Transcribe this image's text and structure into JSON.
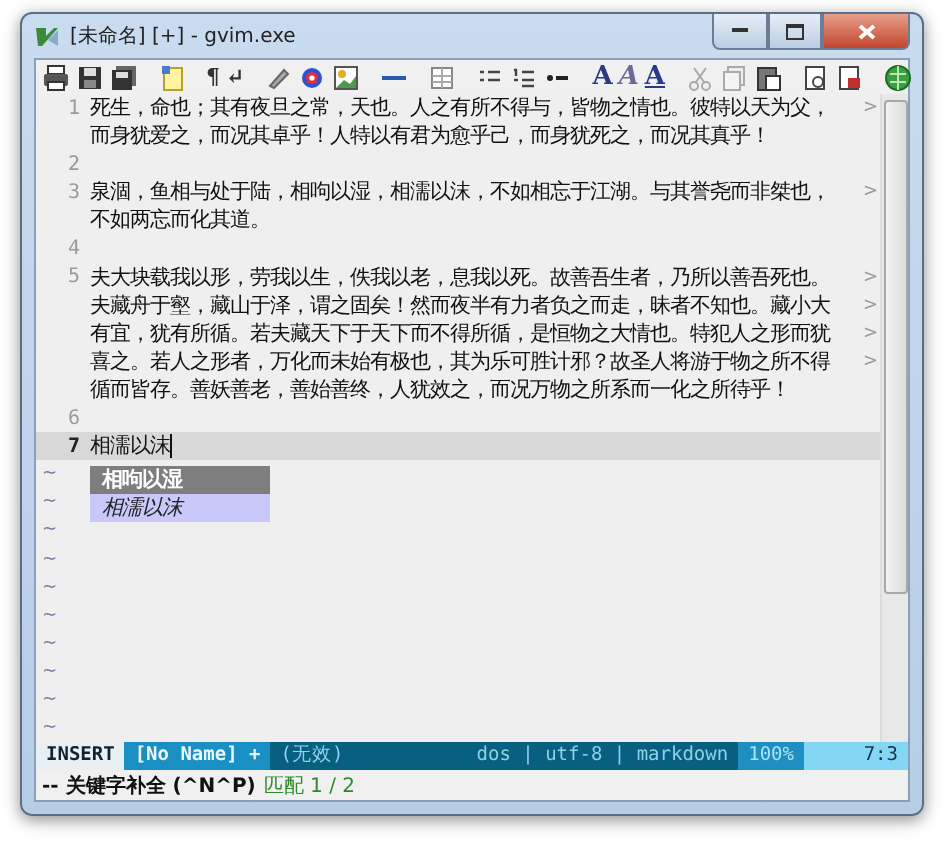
{
  "window": {
    "title": "[未命名] [+] - gvim.exe"
  },
  "toolbar": {
    "glyphs": [
      "¶",
      "↵",
      "A",
      "A",
      "A"
    ]
  },
  "lines": [
    {
      "number": "1",
      "current": false,
      "rows": [
        {
          "text": "死生，命也；其有夜旦之常，天也。人之有所不得与，皆物之情也。彼特以天为父，",
          "marker": ">"
        },
        {
          "text": "而身犹爱之，而况其卓乎！人特以有君为愈乎己，而身犹死之，而况其真乎！"
        }
      ]
    },
    {
      "number": "2",
      "current": false
    },
    {
      "number": "3",
      "current": false,
      "rows": [
        {
          "text": "泉涸，鱼相与处于陆，相呴以湿，相濡以沫，不如相忘于江湖。与其誉尧而非桀也，",
          "marker": ">"
        },
        {
          "text": "不如两忘而化其道。"
        }
      ]
    },
    {
      "number": "4",
      "current": false
    },
    {
      "number": "5",
      "current": false,
      "rows": [
        {
          "text": "夫大块载我以形，劳我以生，佚我以老，息我以死。故善吾生者，乃所以善吾死也。",
          "marker": ">"
        },
        {
          "text": "夫藏舟于壑，藏山于泽，谓之固矣！然而夜半有力者负之而走，昧者不知也。藏小大",
          "marker": ">"
        },
        {
          "text": "有宜，犹有所循。若夫藏天下于天下而不得所循，是恒物之大情也。特犯人之形而犹",
          "marker": ">"
        },
        {
          "text": "喜之。若人之形者，万化而未始有极也，其为乐可胜计邪？故圣人将游于物之所不得",
          "marker": ">"
        },
        {
          "text": "循而皆存。善妖善老，善始善终，人犹效之，而况万物之所系而一化之所待乎！"
        }
      ]
    },
    {
      "number": "6",
      "current": false
    },
    {
      "number": "7",
      "current": true,
      "rows": [
        {
          "text": "相濡以沫"
        }
      ]
    }
  ],
  "popup": [
    {
      "text": "相呴以湿",
      "selected": true
    },
    {
      "text": "相濡以沫",
      "selected": false
    }
  ],
  "filler_rows": [
    "~",
    "~",
    "~",
    "~",
    "~",
    "~",
    "~",
    "~",
    "~",
    "~"
  ],
  "status_line": {
    "mode": "INSERT",
    "file": "[No Name] +",
    "filetype_info": "(无效)",
    "format": "dos | utf-8 | markdown",
    "percent": "100%",
    "position": "7:3"
  },
  "command_line": {
    "message": "-- 关键字补全 (^N^P)",
    "match": "匹配 1 / 2"
  }
}
